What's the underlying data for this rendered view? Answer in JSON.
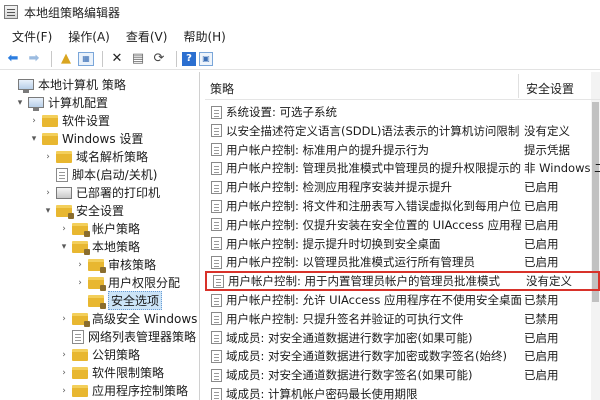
{
  "window": {
    "title": "本地组策略编辑器"
  },
  "menu": [
    "文件(F)",
    "操作(A)",
    "查看(V)",
    "帮助(H)"
  ],
  "toolbar": {
    "icons": [
      "back-icon",
      "forward-icon",
      "up-folder-icon",
      "view-icon",
      "delete-icon",
      "properties-icon",
      "refresh-icon",
      "help-icon",
      "mmc-icon"
    ]
  },
  "tree": {
    "items": [
      {
        "label": "本地计算机 策略",
        "icon": "computer",
        "indent": 0,
        "chevron": ""
      },
      {
        "label": "计算机配置",
        "icon": "computer",
        "indent": 1,
        "chevron": "▾"
      },
      {
        "label": "软件设置",
        "icon": "folder",
        "indent": 2,
        "chevron": "›"
      },
      {
        "label": "Windows 设置",
        "icon": "folder",
        "indent": 2,
        "chevron": "▾"
      },
      {
        "label": "域名解析策略",
        "icon": "folder",
        "indent": 3,
        "chevron": "›"
      },
      {
        "label": "脚本(启动/关机)",
        "icon": "doc",
        "indent": 3,
        "chevron": ""
      },
      {
        "label": "已部署的打印机",
        "icon": "printer",
        "indent": 3,
        "chevron": "›"
      },
      {
        "label": "安全设置",
        "icon": "folder-lock",
        "indent": 3,
        "chevron": "▾"
      },
      {
        "label": "帐户策略",
        "icon": "folder-lock",
        "indent": 4,
        "chevron": "›"
      },
      {
        "label": "本地策略",
        "icon": "folder-lock",
        "indent": 4,
        "chevron": "▾"
      },
      {
        "label": "审核策略",
        "icon": "folder-lock",
        "indent": 5,
        "chevron": "›"
      },
      {
        "label": "用户权限分配",
        "icon": "folder-lock",
        "indent": 5,
        "chevron": "›"
      },
      {
        "label": "安全选项",
        "icon": "folder-lock",
        "indent": 5,
        "chevron": "",
        "selected": true
      },
      {
        "label": "高级安全 Windows",
        "icon": "folder-lock",
        "indent": 4,
        "chevron": "›"
      },
      {
        "label": "网络列表管理器策略",
        "icon": "doc",
        "indent": 4,
        "chevron": ""
      },
      {
        "label": "公钥策略",
        "icon": "folder",
        "indent": 4,
        "chevron": "›"
      },
      {
        "label": "软件限制策略",
        "icon": "folder",
        "indent": 4,
        "chevron": "›"
      },
      {
        "label": "应用程序控制策略",
        "icon": "folder",
        "indent": 4,
        "chevron": "›"
      }
    ]
  },
  "list": {
    "columns": {
      "policy": "策略",
      "setting": "安全设置"
    },
    "rows": [
      {
        "policy": "系统设置: 可选子系统",
        "setting": ""
      },
      {
        "policy": "以安全描述符定义语言(SDDL)语法表示的计算机访问限制",
        "setting": "没有定义"
      },
      {
        "policy": "用户帐户控制: 标准用户的提升提示行为",
        "setting": "提示凭据"
      },
      {
        "policy": "用户帐户控制: 管理员批准模式中管理员的提升权限提示的...",
        "setting": "非 Windows 二"
      },
      {
        "policy": "用户帐户控制: 检测应用程序安装并提示提升",
        "setting": "已启用"
      },
      {
        "policy": "用户帐户控制: 将文件和注册表写入错误虚拟化到每用户位置",
        "setting": "已启用"
      },
      {
        "policy": "用户帐户控制: 仅提升安装在安全位置的 UIAccess 应用程序",
        "setting": "已启用"
      },
      {
        "policy": "用户帐户控制: 提示提升时切换到安全桌面",
        "setting": "已启用"
      },
      {
        "policy": "用户帐户控制: 以管理员批准模式运行所有管理员",
        "setting": "已启用"
      },
      {
        "policy": "用户帐户控制: 用于内置管理员帐户的管理员批准模式",
        "setting": "没有定义",
        "highlight": true
      },
      {
        "policy": "用户帐户控制: 允许 UIAccess 应用程序在不使用安全桌面...",
        "setting": "已禁用"
      },
      {
        "policy": "用户帐户控制: 只提升签名并验证的可执行文件",
        "setting": "已禁用"
      },
      {
        "policy": "域成员: 对安全通道数据进行数字加密(如果可能)",
        "setting": "已启用"
      },
      {
        "policy": "域成员: 对安全通道数据进行数字加密或数字签名(始终)",
        "setting": "已启用"
      },
      {
        "policy": "域成员: 对安全通道数据进行数字签名(如果可能)",
        "setting": "已启用"
      },
      {
        "policy": "域成员: 计算机帐户密码最长使用期限",
        "setting": ""
      }
    ]
  }
}
